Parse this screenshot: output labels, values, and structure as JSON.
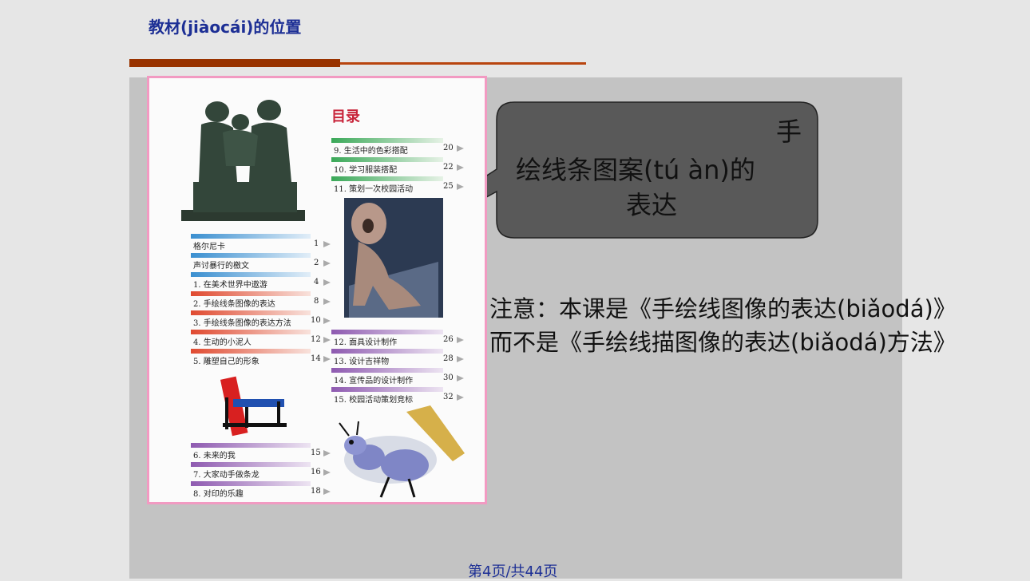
{
  "slide": {
    "title": "教材(jiàocái)的位置",
    "callout": {
      "line1": "手",
      "line2": "绘线条图案(tú àn)的",
      "line3": "表达"
    },
    "note": {
      "line1": "注意：本课是《手绘线图像的表达(biǎodá)》",
      "line2": "而不是《手绘线描图像的表达(biǎodá)方法》"
    },
    "footer": "第4页/共44页",
    "colors": {
      "title": "#1d2f95",
      "rule": "#993300",
      "callout_fill": "#595959",
      "border": "#f29ac2"
    }
  },
  "book": {
    "toc_title": "目录",
    "top_items": [
      {
        "label": "9. 生活中的色彩搭配",
        "page": "20",
        "color": "#3aa858"
      },
      {
        "label": "10. 学习服装搭配",
        "page": "22",
        "color": "#3aa858"
      },
      {
        "label": "11. 策划一次校园活动",
        "page": "25",
        "color": "#3aa858"
      }
    ],
    "left_items": [
      {
        "label": "格尔尼卡",
        "page": "1",
        "color": "#3a8fd0"
      },
      {
        "label": "声讨暴行的檄文",
        "page": "2",
        "color": "#3a8fd0"
      },
      {
        "label": "1. 在美术世界中遨游",
        "page": "4",
        "color": "#3a8fd0"
      },
      {
        "label": "2. 手绘线条图像的表达",
        "page": "8",
        "color": "#e04a30"
      },
      {
        "label": "3. 手绘线条图像的表达方法",
        "page": "10",
        "color": "#e04a30"
      },
      {
        "label": "4. 生动的小泥人",
        "page": "12",
        "color": "#e04a30"
      },
      {
        "label": "5. 雕塑自己的形象",
        "page": "14",
        "color": "#e04a30"
      }
    ],
    "right_items": [
      {
        "label": "12. 面具设计制作",
        "page": "26",
        "color": "#8e5ab0"
      },
      {
        "label": "13. 设计吉祥物",
        "page": "28",
        "color": "#8e5ab0"
      },
      {
        "label": "14. 宣传品的设计制作",
        "page": "30",
        "color": "#8e5ab0"
      },
      {
        "label": "15. 校园活动策划竞标",
        "page": "32",
        "color": "#8e5ab0"
      }
    ],
    "bottom_items": [
      {
        "label": "6. 未来的我",
        "page": "15",
        "color": "#8e5ab0"
      },
      {
        "label": "7. 大家动手做条龙",
        "page": "16",
        "color": "#8e5ab0"
      },
      {
        "label": "8. 对印的乐趣",
        "page": "18",
        "color": "#8e5ab0"
      }
    ]
  }
}
